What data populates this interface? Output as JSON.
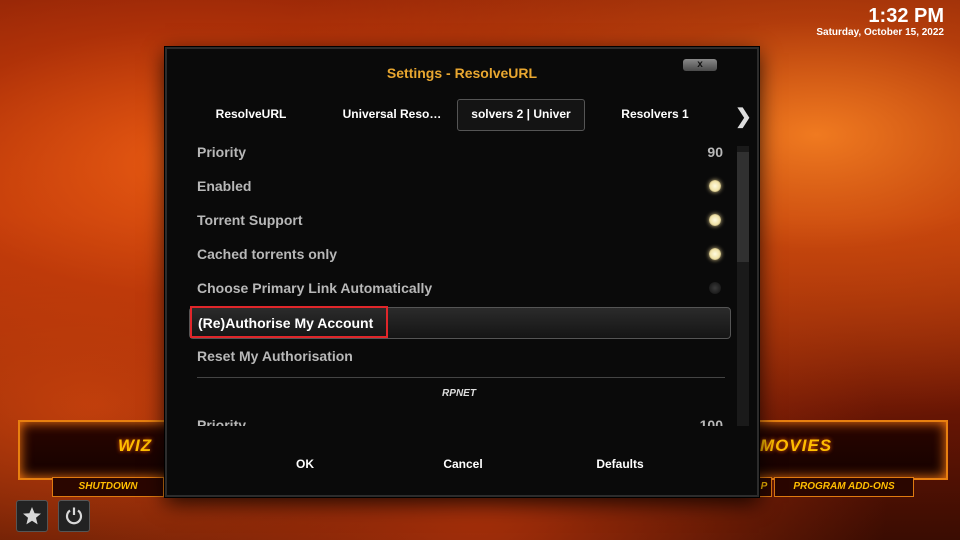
{
  "clock": {
    "time": "1:32 PM",
    "date": "Saturday, October 15, 2022"
  },
  "background_menu": {
    "left_label": "WIZ",
    "right_label": "MOVIES",
    "sub_left": "SHUTDOWN",
    "sub_right": "PROGRAM ADD-ONS",
    "sub_mid_fragment": "P"
  },
  "dialog": {
    "title": "Settings - ResolveURL",
    "close_label": "x",
    "tabs": [
      {
        "label": "ResolveURL"
      },
      {
        "label": "Universal Reso…"
      },
      {
        "label": "solvers 2 | Univer"
      },
      {
        "label": "Resolvers 1"
      }
    ],
    "active_tab": "solvers 2 | Univer",
    "settings": [
      {
        "label": "Priority",
        "value": "90"
      },
      {
        "label": "Enabled",
        "state": "on"
      },
      {
        "label": "Torrent Support",
        "state": "on"
      },
      {
        "label": "Cached torrents only",
        "state": "on"
      },
      {
        "label": "Choose Primary Link Automatically",
        "state": "off"
      },
      {
        "label": "(Re)Authorise My Account"
      },
      {
        "label": "Reset My Authorisation"
      }
    ],
    "group_header": "RPNET",
    "partial_row": {
      "label": "Priority",
      "value": "100"
    },
    "buttons": {
      "ok": "OK",
      "cancel": "Cancel",
      "defaults": "Defaults"
    }
  },
  "icons": {
    "favourites": "star-icon",
    "power": "power-icon"
  },
  "colors": {
    "title": "#e9a730",
    "highlight_box": "#e0262a",
    "menu_text": "#ffbe00"
  }
}
